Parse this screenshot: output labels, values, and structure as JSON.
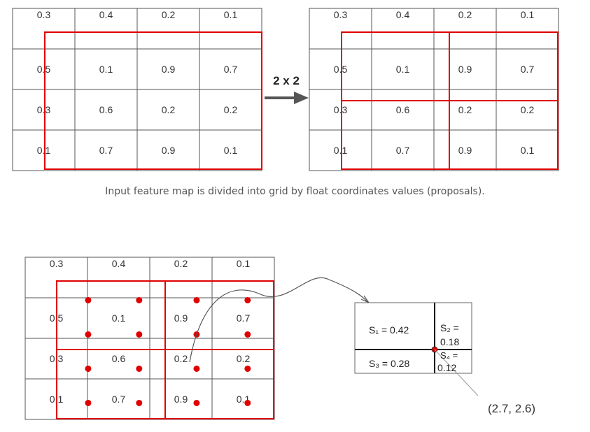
{
  "grids": {
    "top_left": {
      "values": [
        [
          "0.3",
          "0.4",
          "0.2",
          "0.1"
        ],
        [
          "0.5",
          "0.1",
          "0.9",
          "0.7"
        ],
        [
          "0.3",
          "0.6",
          "0.2",
          "0.2"
        ],
        [
          "0.1",
          "0.7",
          "0.9",
          "0.1"
        ]
      ]
    },
    "top_right": {
      "values": [
        [
          "0.3",
          "0.4",
          "0.2",
          "0.1"
        ],
        [
          "0.5",
          "0.1",
          "0.9",
          "0.7"
        ],
        [
          "0.3",
          "0.6",
          "0.2",
          "0.2"
        ],
        [
          "0.1",
          "0.7",
          "0.9",
          "0.1"
        ]
      ]
    },
    "bottom": {
      "values": [
        [
          "0.3",
          "0.4",
          "0.2",
          "0.1"
        ],
        [
          "0.5",
          "0.1",
          "0.9",
          "0.7"
        ],
        [
          "0.3",
          "0.6",
          "0.2",
          "0.2"
        ],
        [
          "0.1",
          "0.7",
          "0.9",
          "0.1"
        ]
      ]
    }
  },
  "arrow_label": "2 x 2",
  "caption": "Input feature map is divided into grid by float coordinates values (proposals).",
  "zoom_box": {
    "s1": "S₁ = 0.42",
    "s2_a": "S₂ =",
    "s2_b": "0.18",
    "s3": "S₃ = 0.28",
    "s4_a": "S₄ =",
    "s4_b": "0.12"
  },
  "point_label": "(2.7, 2.6)",
  "colors": {
    "grid_line": "#555555",
    "proposal": "#e00000",
    "sample_point": "#e00000",
    "arrow": "#555555"
  }
}
